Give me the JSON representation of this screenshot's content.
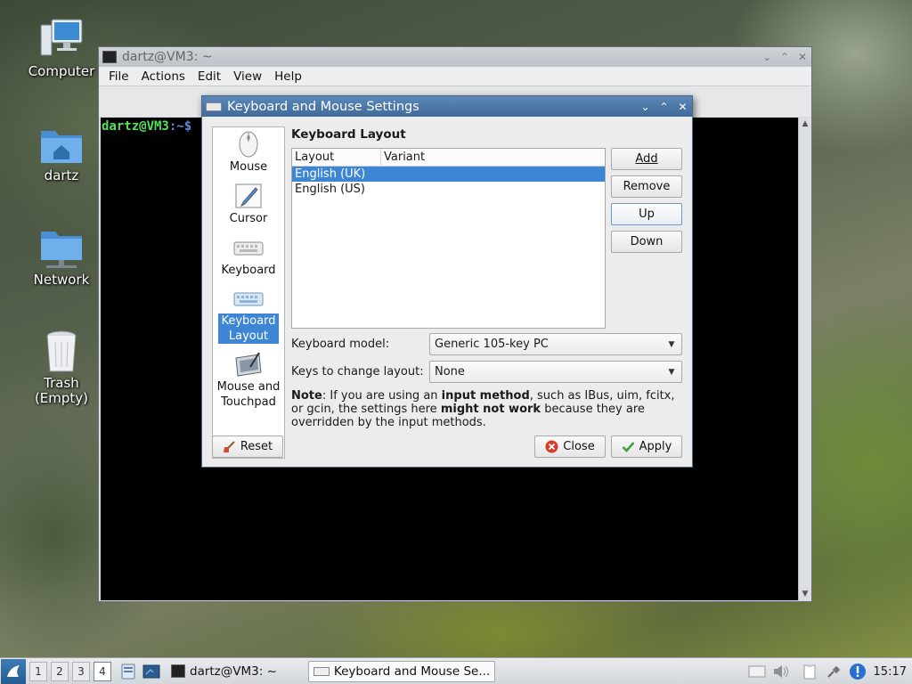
{
  "desktop": {
    "icons": [
      {
        "label": "Computer"
      },
      {
        "label": "dartz"
      },
      {
        "label": "Network"
      },
      {
        "label": "Trash\n(Empty)"
      }
    ]
  },
  "terminal": {
    "title": "dartz@VM3: ~",
    "menu": [
      "File",
      "Actions",
      "Edit",
      "View",
      "Help"
    ],
    "prompt_user": "dartz@VM3",
    "prompt_path": ":~$"
  },
  "dialog": {
    "title": "Keyboard and Mouse Settings",
    "sidebar": [
      {
        "label": "Mouse"
      },
      {
        "label": "Cursor"
      },
      {
        "label": "Keyboard"
      },
      {
        "label": "Keyboard\nLayout",
        "active": true
      },
      {
        "label": "Mouse and\nTouchpad"
      }
    ],
    "section_title": "Keyboard Layout",
    "table": {
      "columns": [
        "Layout",
        "Variant"
      ],
      "rows": [
        {
          "layout": "English (UK)",
          "variant": "",
          "selected": true
        },
        {
          "layout": "English (US)",
          "variant": "",
          "selected": false
        }
      ]
    },
    "buttons": {
      "add": "Add",
      "remove": "Remove",
      "up": "Up",
      "down": "Down",
      "reset": "Reset",
      "close": "Close",
      "apply": "Apply"
    },
    "model_label": "Keyboard model:",
    "model_value": "Generic 105-key PC",
    "keys_label": "Keys to change layout:",
    "keys_value": "None",
    "note": {
      "bold1": "Note",
      "t1": ": If you are using an ",
      "bold2": "input method",
      "t2": ", such as IBus, uim, fcitx, or gcin, the settings here ",
      "bold3": "might not work",
      "t3": " because they are overridden by the input methods."
    }
  },
  "taskbar": {
    "workspaces": [
      "1",
      "2",
      "3",
      "4"
    ],
    "active_workspace": "4",
    "tasks": [
      {
        "label": "dartz@VM3: ~",
        "active": false
      },
      {
        "label": "Keyboard and Mouse Se...",
        "active": true
      }
    ],
    "clock": "15:17"
  },
  "colors": {
    "selection": "#3d86d6",
    "dialog_title": "#4a76a6",
    "terminal_bg": "#000000",
    "prompt_user": "#55e05a"
  }
}
